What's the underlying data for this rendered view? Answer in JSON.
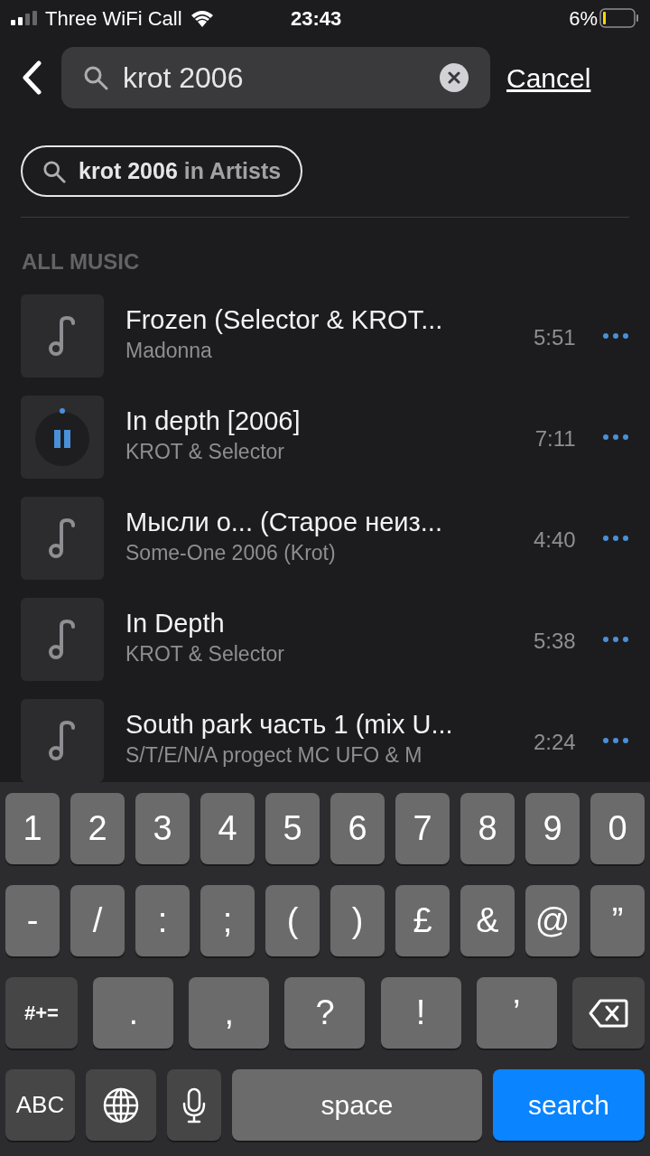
{
  "status_bar": {
    "carrier": "Three WiFi Call",
    "time": "23:43",
    "battery": "6%"
  },
  "search": {
    "value": "krot 2006",
    "cancel": "Cancel"
  },
  "scope_chip": {
    "query": "krot 2006",
    "suffix": "in Artists"
  },
  "section": {
    "title": "ALL MUSIC"
  },
  "tracks": [
    {
      "title": "Frozen (Selector & KROT...",
      "artist": "Madonna",
      "duration": "5:51",
      "playing": false
    },
    {
      "title": "In depth [2006]",
      "artist": "KROT & Selector",
      "duration": "7:11",
      "playing": true
    },
    {
      "title": "Мысли о... (Старое неиз...",
      "artist": "Some-One 2006 (Krot)",
      "duration": "4:40",
      "playing": false
    },
    {
      "title": "In Depth",
      "artist": "KROT & Selector",
      "duration": "5:38",
      "playing": false
    },
    {
      "title": "South park часть 1 (mix U...",
      "artist": "S/T/E/N/A progect MC UFO & M",
      "duration": "2:24",
      "playing": false
    }
  ],
  "keyboard": {
    "key_rows": [
      {
        "keys": [
          {
            "kind": "char",
            "label": "1"
          },
          {
            "kind": "char",
            "label": "2"
          },
          {
            "kind": "char",
            "label": "3"
          },
          {
            "kind": "char",
            "label": "4"
          },
          {
            "kind": "char",
            "label": "5"
          },
          {
            "kind": "char",
            "label": "6"
          },
          {
            "kind": "char",
            "label": "7"
          },
          {
            "kind": "char",
            "label": "8"
          },
          {
            "kind": "char",
            "label": "9"
          },
          {
            "kind": "char",
            "label": "0"
          }
        ]
      },
      {
        "keys": [
          {
            "kind": "char",
            "label": "-"
          },
          {
            "kind": "char",
            "label": "/"
          },
          {
            "kind": "char",
            "label": ":"
          },
          {
            "kind": "char",
            "label": ";"
          },
          {
            "kind": "char",
            "label": "("
          },
          {
            "kind": "char",
            "label": ")"
          },
          {
            "kind": "char",
            "label": "£"
          },
          {
            "kind": "char",
            "label": "&"
          },
          {
            "kind": "char",
            "label": "@"
          },
          {
            "kind": "char",
            "label": "”"
          }
        ]
      },
      {
        "keys": [
          {
            "kind": "special",
            "label": "#+="
          },
          {
            "kind": "wide",
            "label": "."
          },
          {
            "kind": "wide",
            "label": ","
          },
          {
            "kind": "wide",
            "label": "?"
          },
          {
            "kind": "wide",
            "label": "!"
          },
          {
            "kind": "wide",
            "label": "’"
          },
          {
            "kind": "backspace"
          }
        ]
      },
      {
        "keys": [
          {
            "kind": "special",
            "label": "ABC"
          },
          {
            "kind": "globe"
          },
          {
            "kind": "mic"
          },
          {
            "kind": "space",
            "label": "space"
          },
          {
            "kind": "action",
            "label": "search"
          }
        ]
      }
    ]
  }
}
